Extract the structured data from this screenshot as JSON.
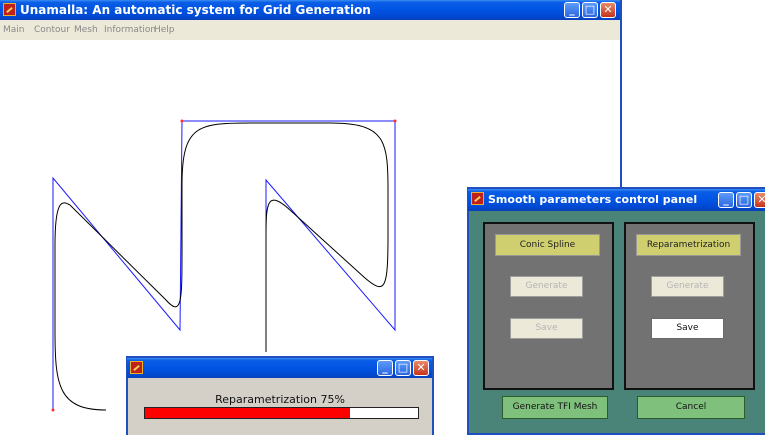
{
  "main_window": {
    "title": "Unamalla: An automatic system for Grid Generation",
    "menu": [
      "Main",
      "Contour",
      "Mesh",
      "Information",
      "Help"
    ]
  },
  "smooth_panel": {
    "title": "Smooth parameters control panel",
    "conic_spline": {
      "label": "Conic Spline",
      "generate_label": "Generate",
      "save_label": "Save"
    },
    "reparametrization": {
      "label": "Reparametrization",
      "generate_label": "Generate",
      "save_label": "Save"
    },
    "generate_tfi_label": "Generate TFI Mesh",
    "cancel_label": "Cancel"
  },
  "progress_dialog": {
    "label": "Reparametrization 75%",
    "progress": 0.75
  },
  "colors": {
    "titlebar": "#0054e3",
    "panel_bg": "#4a8478",
    "group_bg": "#727272",
    "yellow_button": "#cfcf6f",
    "green_button": "#7fc07c",
    "progress_fill": "#ff0000",
    "control_polygon": "#1a1aff",
    "curve": "#000000"
  }
}
